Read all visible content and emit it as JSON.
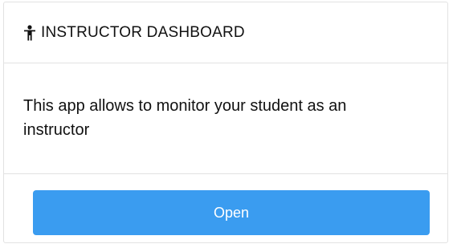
{
  "card": {
    "header": {
      "icon": "person-standing-icon",
      "title": "INSTRUCTOR DASHBOARD"
    },
    "body": {
      "description": "This app allows to monitor your student as an instructor"
    },
    "footer": {
      "open_label": "Open"
    }
  },
  "colors": {
    "button_bg": "#3a9cf0",
    "button_text": "#ffffff",
    "border": "#e2e2e2",
    "text": "#111111"
  }
}
